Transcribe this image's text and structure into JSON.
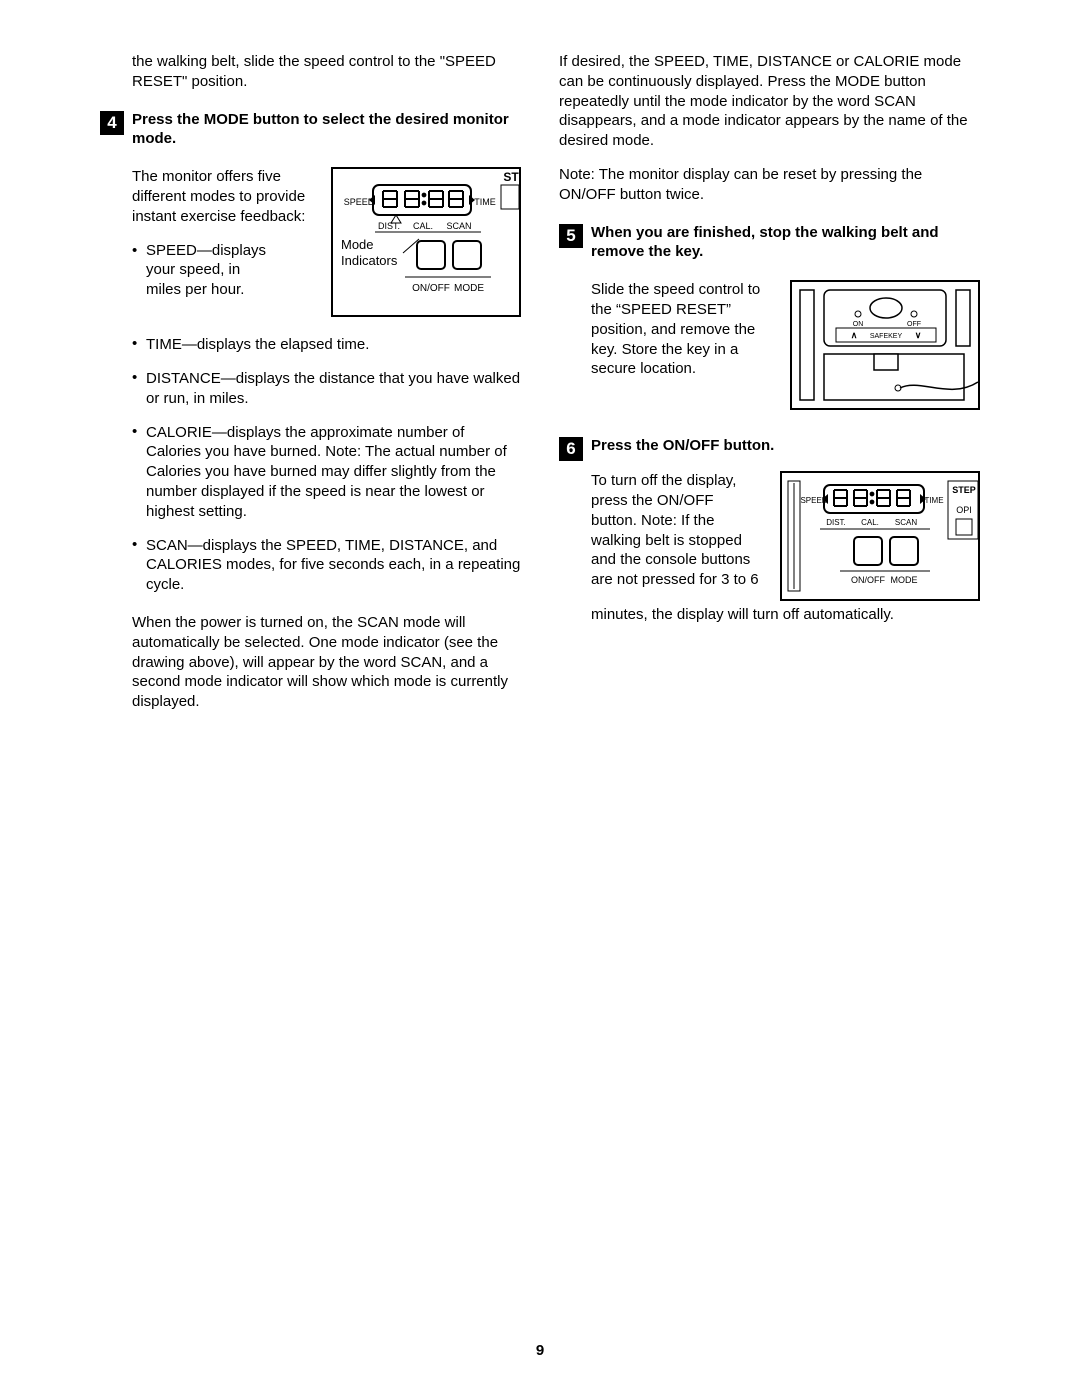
{
  "page_number": "9",
  "left": {
    "intro_p1": "the walking belt, slide the speed control to the \"SPEED RESET\" position.",
    "step4": {
      "num": "4",
      "head": "Press the MODE button to select the desired monitor mode.",
      "para_a": "The monitor offers five different modes to provide instant exercise feedback:",
      "bullet_speed_a": "SPEED—displays",
      "bullet_speed_b": "your speed, in",
      "bullet_speed_c": "miles per hour.",
      "bullet_time": "TIME—displays the elapsed time.",
      "bullet_distance": "DISTANCE—displays the distance that you have walked or run, in miles.",
      "bullet_calorie": "CALORIE—displays the approximate number of Calories you have burned. Note: The actual number of Calories you have burned may differ slightly from the number displayed if the speed is near the lowest or highest setting.",
      "bullet_scan": "SCAN—displays the SPEED, TIME, DISTANCE, and CALORIES modes, for five seconds each, in a repeating cycle.",
      "para_b": "When the power is turned on, the SCAN mode will automatically be selected. One mode indicator (see the drawing above), will appear by the word SCAN, and a second mode indicator will show which mode is currently displayed."
    },
    "fig1": {
      "speed": "SPEED",
      "time": "TIME",
      "dist": "DIST.",
      "cal": "CAL.",
      "scan": "SCAN",
      "mode_label_a": "Mode",
      "mode_label_b": "Indicators",
      "onoff": "ON/OFF",
      "mode": "MODE",
      "tr": "ST"
    }
  },
  "right": {
    "para_a": "If desired, the SPEED, TIME, DISTANCE or CALORIE mode can be continuously displayed. Press the MODE button repeatedly until the mode indicator by the word SCAN disappears, and a mode indicator appears by the name of the desired mode.",
    "para_b": "Note: The monitor display can be reset by pressing the ON/OFF button twice.",
    "step5": {
      "num": "5",
      "head": "When you are finished, stop the walking belt and remove the key.",
      "text": "Slide the speed control to the “SPEED RESET” position, and remove the key. Store the key in a secure location."
    },
    "fig2": {
      "on": "ON",
      "off": "OFF",
      "safekey": "SAFEKEY",
      "arrow_up": "∧",
      "arrow_down": "∨"
    },
    "step6": {
      "num": "6",
      "head": "Press the ON/OFF button.",
      "text1": "To turn off the display, press the ON/OFF button. Note: If the walking belt is stopped and the console buttons are not pressed for 3 to 6",
      "text2": "minutes, the display will turn off automatically."
    },
    "fig3": {
      "speed": "SPEED",
      "time": "TIME",
      "dist": "DIST.",
      "cal": "CAL.",
      "scan": "SCAN",
      "onoff": "ON/OFF",
      "mode": "MODE",
      "tr1": "STEP",
      "tr2": "OPI"
    }
  }
}
